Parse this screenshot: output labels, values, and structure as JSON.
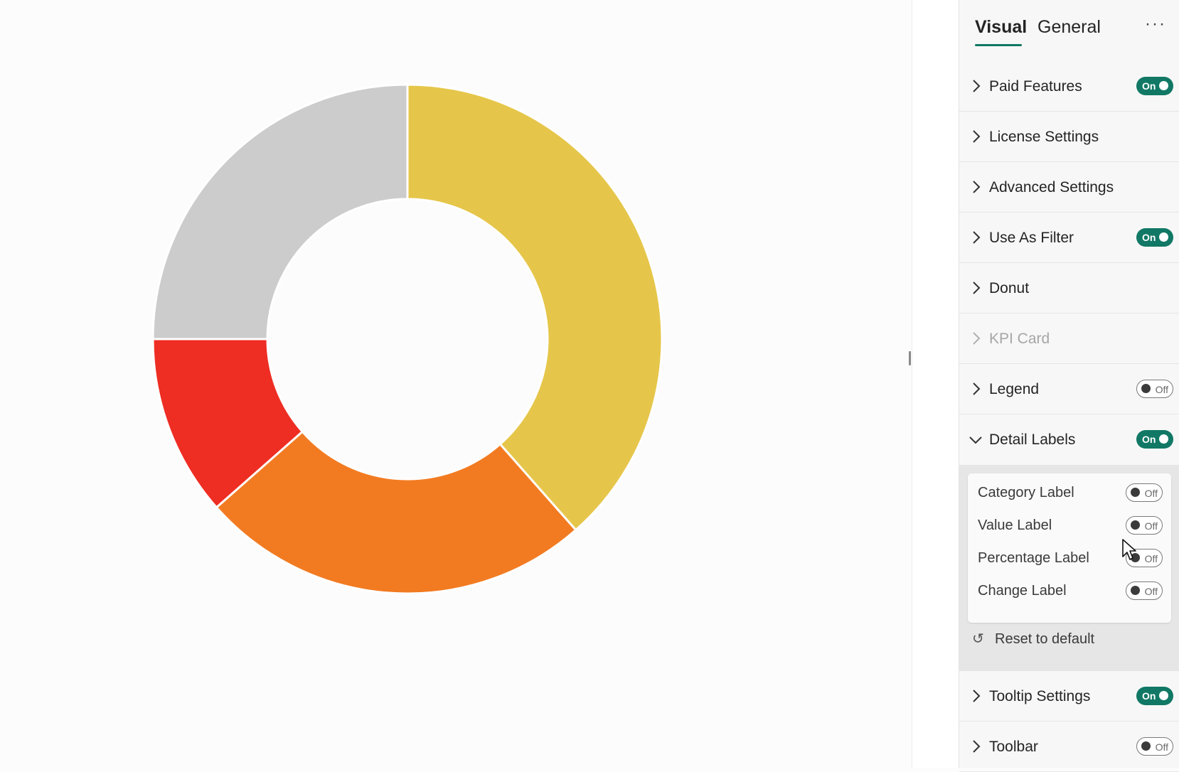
{
  "chart_data": {
    "type": "donut",
    "title": "",
    "slices": [
      {
        "value": 38.5,
        "color": "#E6C64A"
      },
      {
        "value": 25.0,
        "color": "#F27B22"
      },
      {
        "value": 11.5,
        "color": "#EE2D23"
      },
      {
        "value": 25.0,
        "color": "#CCCCCC"
      }
    ],
    "legend": "off",
    "labels": "off"
  },
  "panel": {
    "tabs": [
      {
        "label": "Visual",
        "active": true
      },
      {
        "label": "General",
        "active": false
      }
    ],
    "more_icon": "more-horizontal-icon",
    "accent_color": "#117865",
    "sections": [
      {
        "label": "Paid Features",
        "toggle": "On"
      },
      {
        "label": "License Settings",
        "toggle": ""
      },
      {
        "label": "Advanced Settings",
        "toggle": ""
      },
      {
        "label": "Use As Filter",
        "toggle": "On"
      },
      {
        "label": "Donut",
        "toggle": ""
      },
      {
        "label": "KPI Card",
        "toggle": "",
        "disabled": true
      },
      {
        "label": "Legend",
        "toggle": "Off"
      },
      {
        "label": "Detail Labels",
        "toggle": "On",
        "expanded": true
      },
      {
        "label": "Tooltip Settings",
        "toggle": "On"
      },
      {
        "label": "Toolbar",
        "toggle": "Off"
      }
    ],
    "detail_labels": {
      "options": [
        {
          "label": "Category Label",
          "toggle": "Off"
        },
        {
          "label": "Value Label",
          "toggle": "Off"
        },
        {
          "label": "Percentage Label",
          "toggle": "Off"
        },
        {
          "label": "Change Label",
          "toggle": "Off"
        }
      ],
      "reset_label": "Reset to default",
      "reset_icon": "undo-icon"
    }
  }
}
